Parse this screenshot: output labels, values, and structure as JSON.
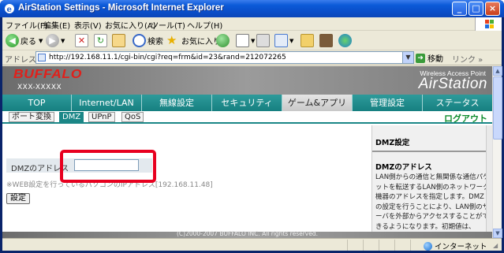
{
  "window": {
    "title": "AirStation Settings - Microsoft Internet Explorer"
  },
  "menu": [
    "ファイル(F)",
    "編集(E)",
    "表示(V)",
    "お気に入り(A)",
    "ツール(T)",
    "ヘルプ(H)"
  ],
  "toolbar": {
    "back_label": "戻る",
    "search_label": "検索",
    "favorites_label": "お気に入り"
  },
  "address": {
    "label": "アドレス(D)",
    "url": "http://192.168.11.1/cgi-bin/cgi?req=frm&id=23&rand=212072265",
    "go_label": "移動",
    "links_label": "リンク »"
  },
  "brand": {
    "logo": "BUFFALO",
    "model": "XXX-XXXXX",
    "tagline": "Wireless Access Point",
    "product": "AirStation"
  },
  "nav": [
    {
      "label": "TOP",
      "active": false
    },
    {
      "label": "Internet/LAN",
      "active": false
    },
    {
      "label": "無線設定",
      "active": false
    },
    {
      "label": "セキュリティ",
      "active": false
    },
    {
      "label": "ゲーム&アプリ",
      "active": true
    },
    {
      "label": "管理設定",
      "active": false
    },
    {
      "label": "ステータス",
      "active": false
    }
  ],
  "subnav": [
    {
      "label": "ポート変換",
      "active": false
    },
    {
      "label": "DMZ",
      "active": true
    },
    {
      "label": "UPnP",
      "active": false
    },
    {
      "label": "QoS",
      "active": false
    }
  ],
  "logout_label": "ログアウト",
  "form": {
    "dmz_label": "DMZのアドレス",
    "dmz_value": "",
    "hint": "※WEB設定を行っているパソコンのIPアドレス[192.168.11.48]",
    "submit_label": "設定"
  },
  "help": {
    "title": "DMZ設定",
    "subtitle": "DMZのアドレス",
    "text": "LAN側からの通信と無関係な通信パケットを転送するLAN側のネットワーク機器のアドレスを指定します。DMZの設定を行うことにより、LAN側のサーバを外部からアクセスすることができるようになります。初期値は、"
  },
  "footer": "(C)2000-2007 BUFFALO INC. All rights reserved.",
  "status": {
    "zone": "インターネット"
  },
  "colors": {
    "nav_bg": "#167f80",
    "highlight": "#e8001f",
    "logo_red": "#e0201b",
    "logout_green": "#0a8a2a"
  }
}
